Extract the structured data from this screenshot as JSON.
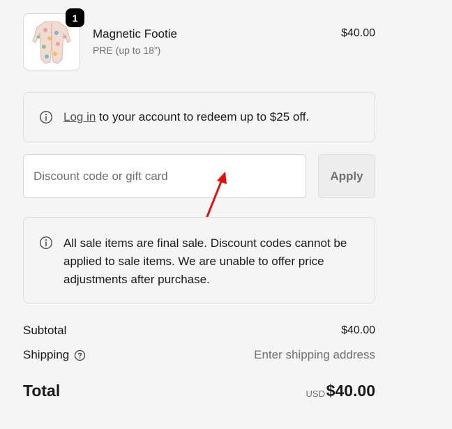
{
  "product": {
    "name": "Magnetic Footie",
    "variant": "PRE (up to 18”)",
    "price": "$40.00",
    "quantity": "1",
    "image_icon": "baby-footie-pajama-thumbnail"
  },
  "login_notice": {
    "link_text": "Log in",
    "text": " to your account to redeem up to $25 off.",
    "icon": "info-icon"
  },
  "discount": {
    "placeholder": "Discount code or gift card",
    "value": "",
    "apply_label": "Apply"
  },
  "annotation": {
    "arrow_color": "#e01010"
  },
  "sale_notice": {
    "text": "All sale items are final sale. Discount codes cannot be applied to sale items. We are unable to offer price adjustments after purchase.",
    "icon": "info-icon"
  },
  "summary": {
    "subtotal_label": "Subtotal",
    "subtotal_value": "$40.00",
    "shipping_label": "Shipping",
    "shipping_value": "Enter shipping address",
    "total_label": "Total",
    "currency": "USD",
    "total_value": "$40.00"
  },
  "colors": {
    "background": "#f5f5f5",
    "text": "#1a1a1a",
    "muted": "#707070",
    "badge": "#000000"
  }
}
